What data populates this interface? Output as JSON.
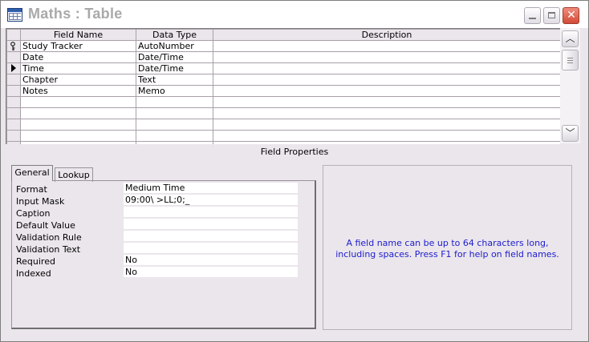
{
  "window": {
    "title": "Maths : Table"
  },
  "grid": {
    "headers": [
      "Field Name",
      "Data Type",
      "Description"
    ],
    "rows": [
      {
        "marker": "key",
        "name": "Study Tracker",
        "type": "AutoNumber",
        "desc": ""
      },
      {
        "marker": "",
        "name": "Date",
        "type": "Date/Time",
        "desc": ""
      },
      {
        "marker": "arrow",
        "name": "Time",
        "type": "Date/Time",
        "desc": ""
      },
      {
        "marker": "",
        "name": "Chapter",
        "type": "Text",
        "desc": ""
      },
      {
        "marker": "",
        "name": "Notes",
        "type": "Memo",
        "desc": ""
      },
      {
        "marker": "",
        "name": "",
        "type": "",
        "desc": ""
      },
      {
        "marker": "",
        "name": "",
        "type": "",
        "desc": ""
      },
      {
        "marker": "",
        "name": "",
        "type": "",
        "desc": ""
      },
      {
        "marker": "",
        "name": "",
        "type": "",
        "desc": ""
      },
      {
        "marker": "",
        "name": "",
        "type": "",
        "desc": ""
      }
    ]
  },
  "field_properties": {
    "label": "Field Properties",
    "tabs": [
      "General",
      "Lookup"
    ],
    "active_tab": "General",
    "properties": [
      {
        "name": "Format",
        "value": "Medium Time"
      },
      {
        "name": "Input Mask",
        "value": "09:00\\ >LL;0;_"
      },
      {
        "name": "Caption",
        "value": ""
      },
      {
        "name": "Default Value",
        "value": ""
      },
      {
        "name": "Validation Rule",
        "value": ""
      },
      {
        "name": "Validation Text",
        "value": ""
      },
      {
        "name": "Required",
        "value": "No"
      },
      {
        "name": "Indexed",
        "value": "No"
      }
    ],
    "help_text": "A field name can be up to 64 characters long, including spaces.  Press F1 for help on field names."
  },
  "colors": {
    "help_text": "#1c1ccc",
    "title_text": "#a9a9a9",
    "panel_bg": "#ebe6ec"
  }
}
